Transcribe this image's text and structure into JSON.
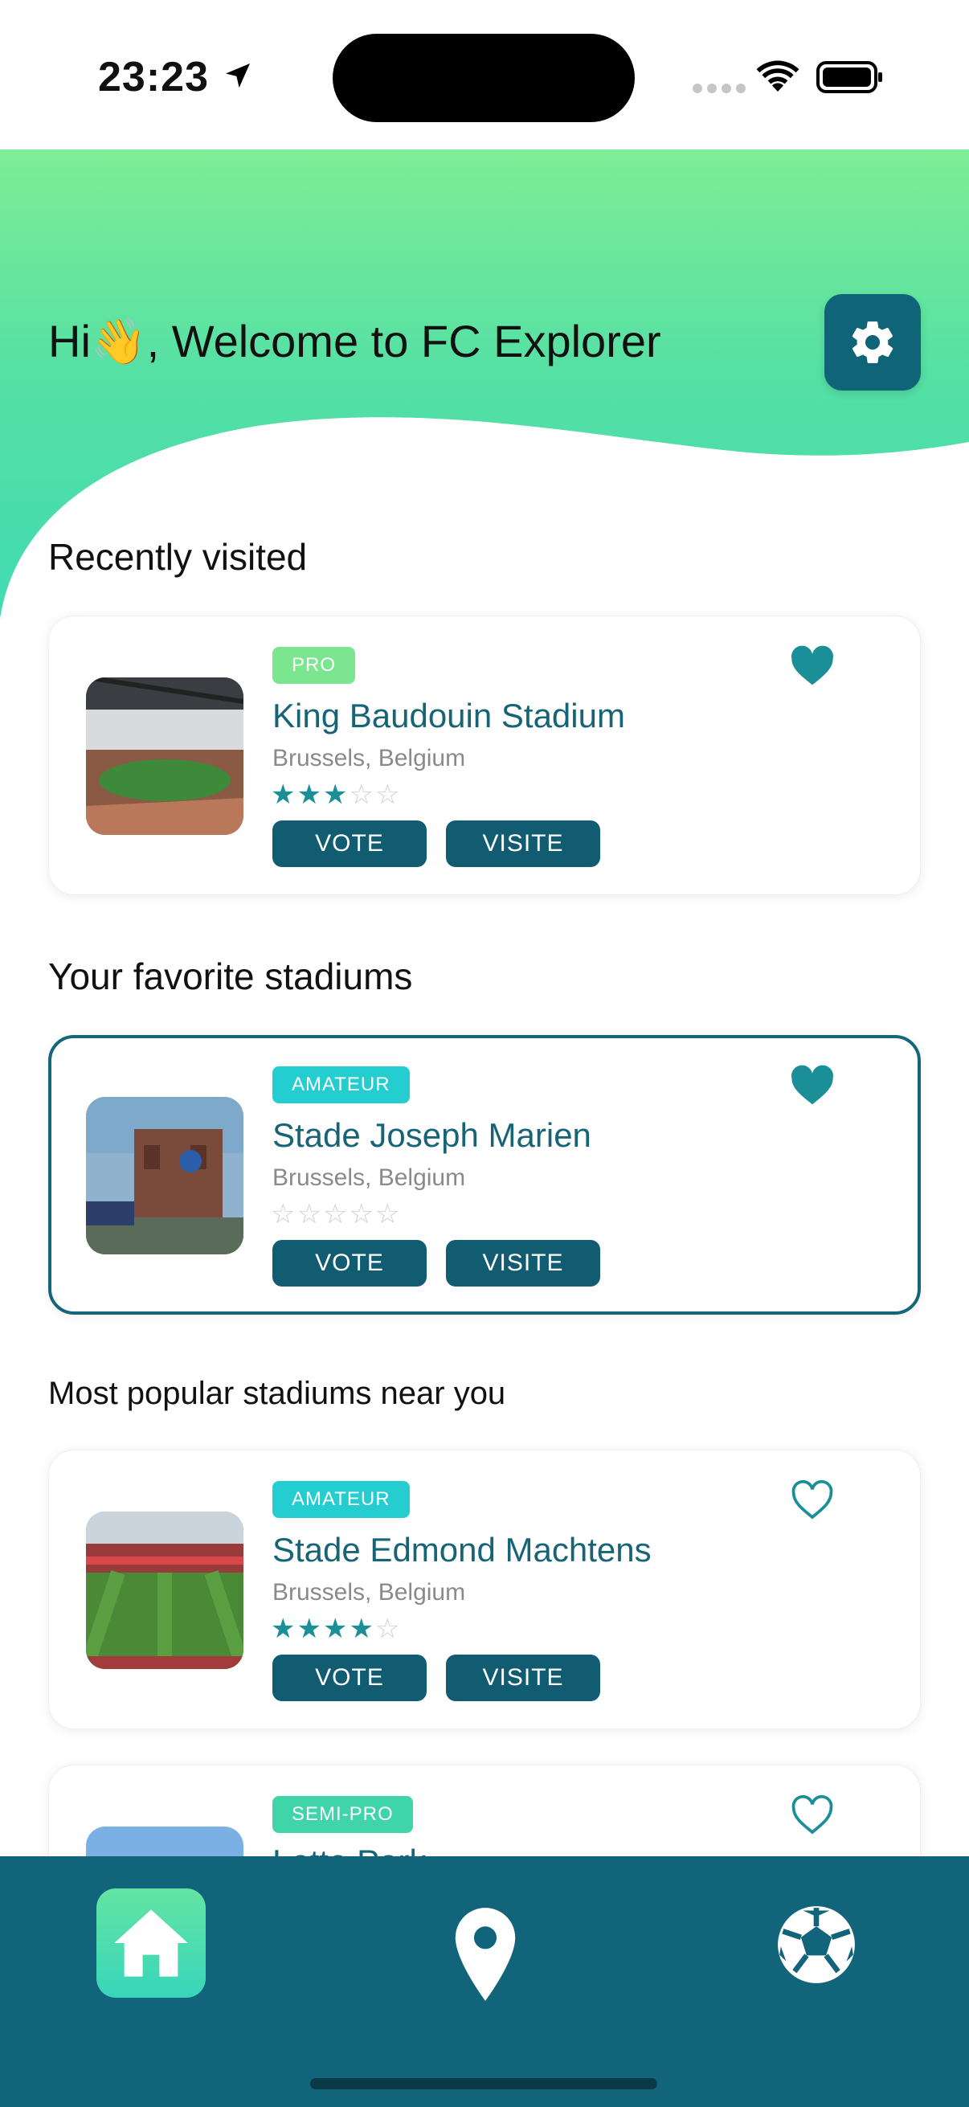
{
  "status_bar": {
    "time": "23:23"
  },
  "header": {
    "greeting": "Hi👋, Welcome to FC Explorer"
  },
  "sections": {
    "recent": "Recently visited",
    "favorites": "Your favorite stadiums",
    "popular": "Most popular stadiums near you"
  },
  "cards": [
    {
      "badge": "PRO",
      "badge_color": "#7ce58f",
      "title": "King Baudouin Stadium",
      "location": "Brussels, Belgium",
      "rating": 3,
      "favorite": true,
      "vote": "VOTE",
      "visite": "VISITE"
    },
    {
      "badge": "AMATEUR",
      "badge_color": "#23cdd0",
      "title": "Stade Joseph Marien",
      "location": "Brussels, Belgium",
      "rating": 0,
      "favorite": true,
      "vote": "VOTE",
      "visite": "VISITE"
    },
    {
      "badge": "AMATEUR",
      "badge_color": "#23cdd0",
      "title": "Stade Edmond Machtens",
      "location": "Brussels, Belgium",
      "rating": 4,
      "favorite": false,
      "vote": "VOTE",
      "visite": "VISITE"
    },
    {
      "badge": "SEMI-PRO",
      "badge_color": "#3fd5a9",
      "title": "Lotto Park",
      "favorite": false
    }
  ],
  "tabs": [
    "home-icon",
    "map-pin-icon",
    "soccer-ball-icon"
  ],
  "colors": {
    "primary": "#11647a",
    "accent": "#1a8f98",
    "gradient_top": "#7eed96",
    "gradient_bottom": "#3fdab3"
  }
}
